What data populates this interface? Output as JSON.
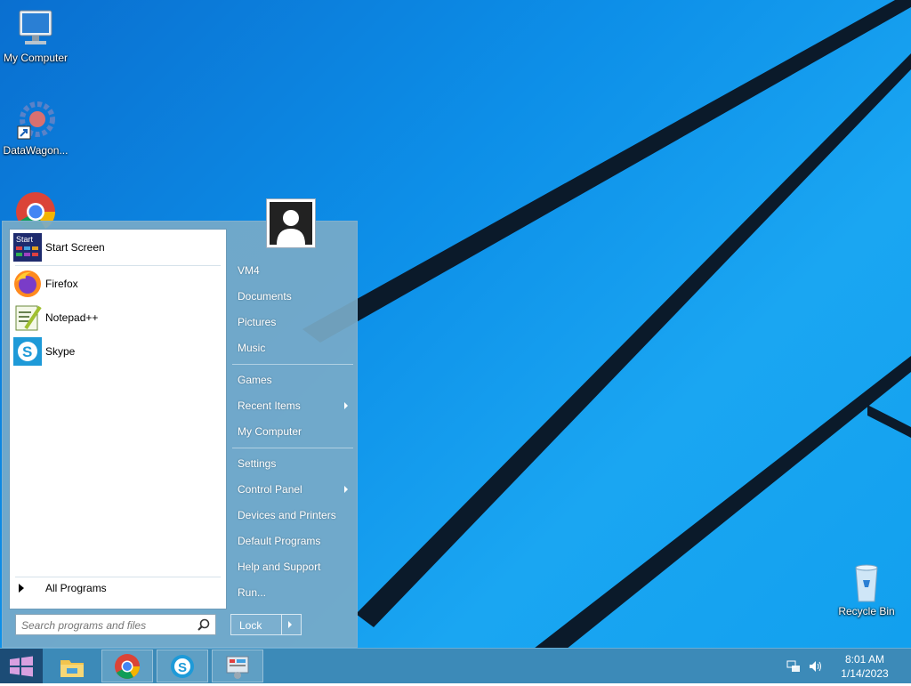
{
  "desktop": {
    "icons": [
      {
        "label": "My Computer"
      },
      {
        "label": "DataWagon..."
      },
      {
        "label": "Recycle Bin"
      }
    ]
  },
  "start_menu": {
    "pinned": [
      {
        "label": "Start Screen",
        "icon": "start-screen-icon"
      },
      {
        "label": "Firefox",
        "icon": "firefox-icon"
      },
      {
        "label": "Notepad++",
        "icon": "notepadpp-icon"
      },
      {
        "label": "Skype",
        "icon": "skype-icon"
      }
    ],
    "start_screen_tile_text": "Start",
    "all_programs": "All Programs",
    "search_placeholder": "Search programs and files",
    "right_items": [
      {
        "label": "VM4"
      },
      {
        "label": "Documents"
      },
      {
        "label": "Pictures"
      },
      {
        "label": "Music"
      },
      {
        "label": "Games"
      },
      {
        "label": "Recent Items"
      },
      {
        "label": "My Computer"
      },
      {
        "label": "Settings"
      },
      {
        "label": "Control Panel"
      },
      {
        "label": "Devices and Printers"
      },
      {
        "label": "Default Programs"
      },
      {
        "label": "Help and Support"
      },
      {
        "label": "Run..."
      }
    ],
    "lock_label": "Lock"
  },
  "taskbar": {
    "buttons": [
      "file-explorer-icon",
      "chrome-icon",
      "skype-icon",
      "control-panel-icon"
    ],
    "clock_time": "8:01 AM",
    "clock_date": "1/14/2023"
  },
  "colors": {
    "desktop_blue": "#0d8fe8",
    "taskbar": "#3c8ab8",
    "start_menu": "#78aac8"
  }
}
